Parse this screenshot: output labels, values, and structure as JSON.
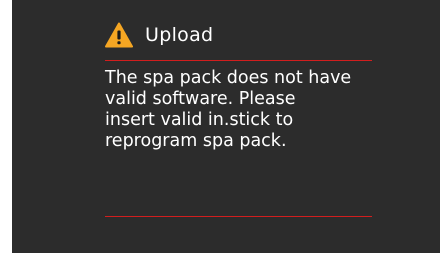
{
  "dialog": {
    "title": "Upload",
    "icon": "warning-icon",
    "message": "The spa pack does not have\nvalid software.  Please\ninsert valid in.stick to\nreprogram spa pack."
  },
  "colors": {
    "background": "#2c2c2c",
    "text": "#ffffff",
    "divider": "#d21e1e",
    "warning": "#f5a623"
  }
}
